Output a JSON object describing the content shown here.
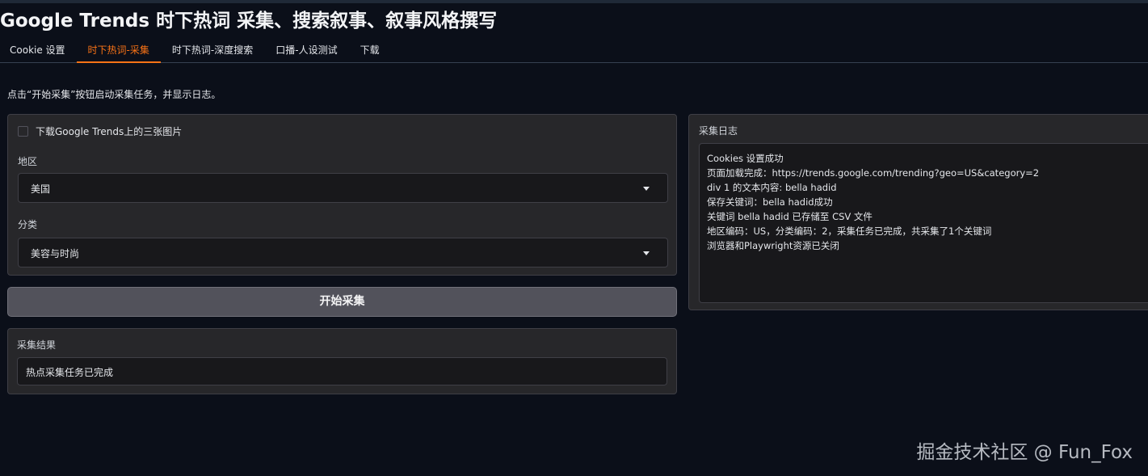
{
  "app": {
    "title": "Google Trends 时下热词 采集、搜索叙事、叙事风格撰写"
  },
  "tabs": [
    {
      "label": "Cookie 设置",
      "active": false
    },
    {
      "label": "时下热词-采集",
      "active": true
    },
    {
      "label": "时下热词-深度搜索",
      "active": false
    },
    {
      "label": "口播-人设测试",
      "active": false
    },
    {
      "label": "下载",
      "active": false
    }
  ],
  "hint": "点击“开始采集”按钮启动采集任务，并显示日志。",
  "options": {
    "download_images_label": "下载Google Trends上的三张图片",
    "download_images_checked": false,
    "region": {
      "label": "地区",
      "value": "美国"
    },
    "category": {
      "label": "分类",
      "value": "美容与时尚"
    }
  },
  "start_button": "开始采集",
  "result": {
    "label": "采集结果",
    "value": "热点采集任务已完成"
  },
  "log": {
    "label": "采集日志",
    "lines": [
      "Cookies 设置成功",
      "页面加载完成：https://trends.google.com/trending?geo=US&category=2",
      "div 1 的文本内容: bella hadid",
      "保存关键词：bella hadid成功",
      "关键词 bella hadid 已存储至 CSV 文件",
      "地区编码：US，分类编码：2，采集任务已完成，共采集了1个关键词",
      "浏览器和Playwright资源已关闭"
    ]
  },
  "watermark": "掘金技术社区 @ Fun_Fox",
  "colors": {
    "accent": "#f97316",
    "background": "#0b0f19",
    "panel": "#27272a"
  }
}
